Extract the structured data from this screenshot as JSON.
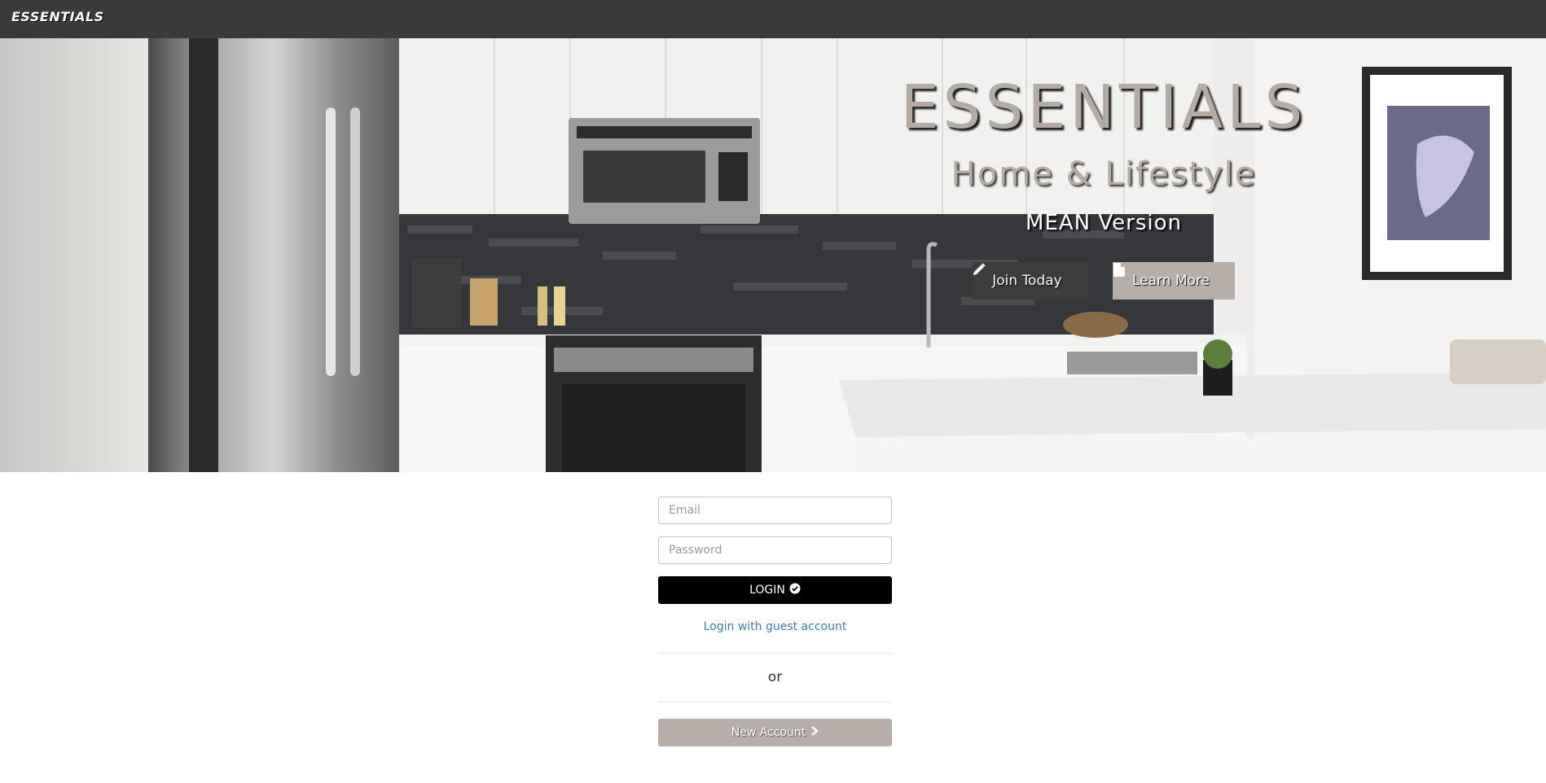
{
  "navbar": {
    "brand": "ESSENTIALS"
  },
  "hero": {
    "title": "ESSENTIALS",
    "subtitle": "Home & Lifestyle",
    "version": "MEAN Version",
    "join_label": "Join Today",
    "join_icon": "pencil-icon",
    "learn_label": "Learn More",
    "learn_icon": "file-icon"
  },
  "login": {
    "email_placeholder": "Email",
    "password_placeholder": "Password",
    "login_label": "LOGIN",
    "login_icon": "check-circle-icon",
    "guest_link": "Login with guest account",
    "or_text": "or",
    "new_account_label": "New Account",
    "new_account_icon": "chevron-right-icon"
  },
  "colors": {
    "navbar_bg": "#3a3a3a",
    "link": "#3f7fb6",
    "login_bg": "#000000",
    "new_account_bg": "#b7aea9"
  }
}
